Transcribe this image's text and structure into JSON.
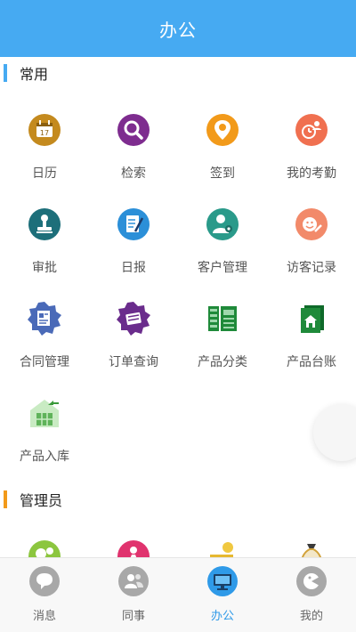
{
  "header": {
    "title": "办公"
  },
  "sections": {
    "common": {
      "title": "常用",
      "bar_color": "#46aaf2",
      "items": [
        {
          "label": "日历",
          "icon": "calendar-icon",
          "color": "#c48a1e"
        },
        {
          "label": "检索",
          "icon": "search-icon",
          "color": "#7e2c8f"
        },
        {
          "label": "签到",
          "icon": "location-pin-icon",
          "color": "#f29a1a"
        },
        {
          "label": "我的考勤",
          "icon": "attendance-clock-icon",
          "color": "#f07050"
        },
        {
          "label": "审批",
          "icon": "stamp-icon",
          "color": "#1d6f7a"
        },
        {
          "label": "日报",
          "icon": "report-pen-icon",
          "color": "#2b8fd8"
        },
        {
          "label": "客户管理",
          "icon": "customer-icon",
          "color": "#2a9a8a"
        },
        {
          "label": "访客记录",
          "icon": "visitor-record-icon",
          "color": "#f28a6a"
        },
        {
          "label": "合同管理",
          "icon": "contract-gear-icon",
          "color": "#4a6ab8"
        },
        {
          "label": "订单查询",
          "icon": "order-gear-icon",
          "color": "#6a2c8c"
        },
        {
          "label": "产品分类",
          "icon": "product-category-icon",
          "color": "#1f8a3a"
        },
        {
          "label": "产品台账",
          "icon": "product-ledger-icon",
          "color": "#1f8a3a"
        },
        {
          "label": "产品入库",
          "icon": "warehouse-icon",
          "color": "#7cc47a"
        }
      ]
    },
    "admin": {
      "title": "管理员",
      "bar_color": "#f29a1a",
      "items": [
        {
          "label": "",
          "icon": "admin-gear-icon",
          "color": "#8cc63f"
        },
        {
          "label": "",
          "icon": "admin-person-icon",
          "color": "#e0336e"
        },
        {
          "label": "",
          "icon": "admin-money-icon",
          "color": "#e6b830"
        },
        {
          "label": "",
          "icon": "admin-money-bag-icon",
          "color": "#d2a23a"
        }
      ]
    }
  },
  "tabbar": {
    "items": [
      {
        "label": "消息",
        "icon": "message-bubble-icon",
        "active": false
      },
      {
        "label": "同事",
        "icon": "colleagues-icon",
        "active": false
      },
      {
        "label": "办公",
        "icon": "office-monitor-icon",
        "active": true
      },
      {
        "label": "我的",
        "icon": "profile-icon",
        "active": false
      }
    ],
    "active_color": "#2f9ae8",
    "inactive_color": "#a8a8a8"
  }
}
